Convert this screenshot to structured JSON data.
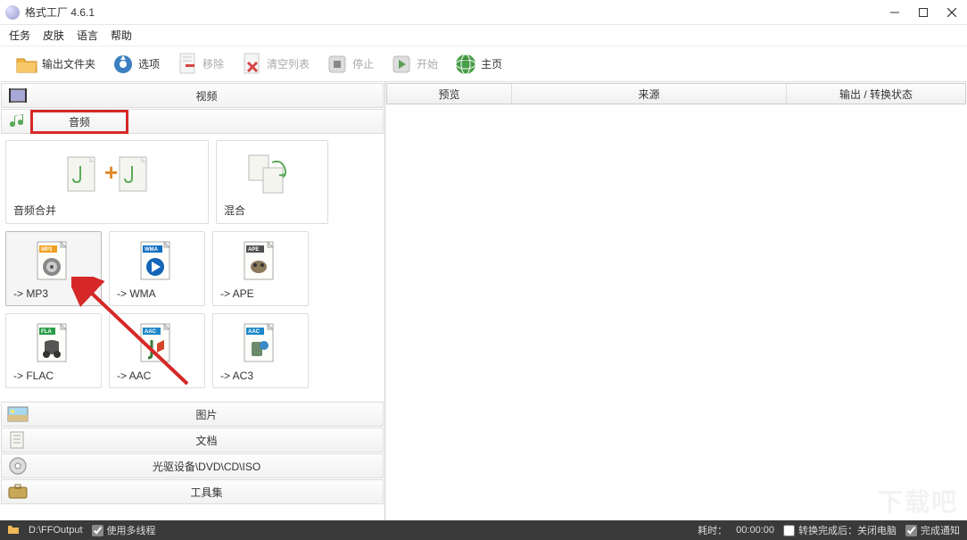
{
  "window": {
    "title": "格式工厂 4.6.1"
  },
  "menu": {
    "task": "任务",
    "skin": "皮肤",
    "language": "语言",
    "help": "帮助"
  },
  "toolbar": {
    "output_folder": "输出文件夹",
    "options": "选项",
    "remove": "移除",
    "clear_list": "清空列表",
    "stop": "停止",
    "start": "开始",
    "homepage": "主页"
  },
  "categories": {
    "video": "视频",
    "audio": "音频",
    "picture": "图片",
    "document": "文档",
    "optical": "光驱设备\\DVD\\CD\\ISO",
    "toolset": "工具集"
  },
  "audio_tiles": {
    "merge": "音频合并",
    "mix": "混合",
    "mp3": "-> MP3",
    "wma": "-> WMA",
    "ape": "-> APE",
    "flac": "-> FLAC",
    "aac": "-> AAC",
    "ac3": "-> AC3"
  },
  "badges": {
    "mp3": "MP3",
    "wma": "WMA",
    "ape": "APE",
    "fla": "FLA",
    "aac": "AAC",
    "ac3": "AAC"
  },
  "table": {
    "preview": "预览",
    "source": "来源",
    "output_status": "输出 / 转换状态"
  },
  "status": {
    "path": "D:\\FFOutput",
    "multithread": "使用多线程",
    "elapsed_label": "耗时：",
    "elapsed_value": "00:00:00",
    "after_convert": "转换完成后：关闭电脑",
    "notify": "完成通知"
  },
  "watermark": "下载吧",
  "colors": {
    "highlight_red": "#d62828",
    "badge_mp3": "#f0a020",
    "badge_wma": "#1070c0",
    "badge_ape": "#505050",
    "badge_fla": "#2a9d4a",
    "badge_aac": "#1e88c8"
  }
}
